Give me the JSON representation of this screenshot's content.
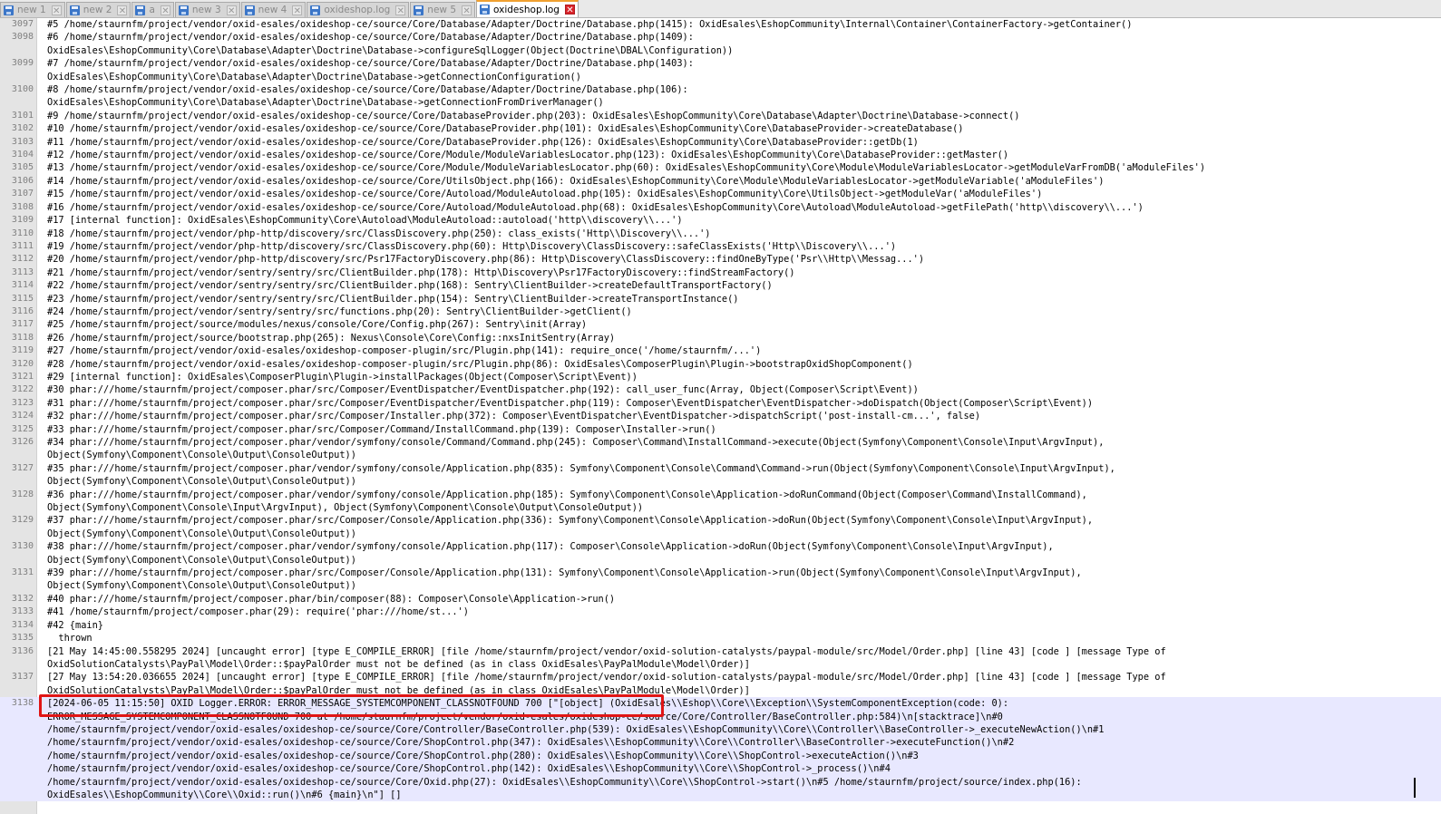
{
  "tabs": [
    {
      "label": "new 1",
      "active": false
    },
    {
      "label": "new 2",
      "active": false
    },
    {
      "label": "a",
      "active": false
    },
    {
      "label": "new 3",
      "active": false
    },
    {
      "label": "new 4",
      "active": false
    },
    {
      "label": "oxideshop.log",
      "active": false
    },
    {
      "label": "new 5",
      "active": false
    },
    {
      "label": "oxideshop.log",
      "active": true
    }
  ],
  "icons": {
    "tab_file": "save-disk-icon",
    "tab_close": "close-icon"
  },
  "colors": {
    "current_line_bg": "#e8e8ff",
    "highlight_box": "#e01515",
    "gutter_bg": "#e4e4e4",
    "active_tab_close": "#d9242b"
  },
  "editor": {
    "current_line": "3138",
    "lines": [
      {
        "num": "3097",
        "text": "#5 /home/staurnfm/project/vendor/oxid-esales/oxideshop-ce/source/Core/Database/Adapter/Doctrine/Database.php(1415): OxidEsales\\EshopCommunity\\Internal\\Container\\ContainerFactory->getContainer()"
      },
      {
        "num": "3098",
        "text": "#6 /home/staurnfm/project/vendor/oxid-esales/oxideshop-ce/source/Core/Database/Adapter/Doctrine/Database.php(1409):\nOxidEsales\\EshopCommunity\\Core\\Database\\Adapter\\Doctrine\\Database->configureSqlLogger(Object(Doctrine\\DBAL\\Configuration))"
      },
      {
        "num": "3099",
        "text": "#7 /home/staurnfm/project/vendor/oxid-esales/oxideshop-ce/source/Core/Database/Adapter/Doctrine/Database.php(1403):\nOxidEsales\\EshopCommunity\\Core\\Database\\Adapter\\Doctrine\\Database->getConnectionConfiguration()"
      },
      {
        "num": "3100",
        "text": "#8 /home/staurnfm/project/vendor/oxid-esales/oxideshop-ce/source/Core/Database/Adapter/Doctrine/Database.php(106):\nOxidEsales\\EshopCommunity\\Core\\Database\\Adapter\\Doctrine\\Database->getConnectionFromDriverManager()"
      },
      {
        "num": "3101",
        "text": "#9 /home/staurnfm/project/vendor/oxid-esales/oxideshop-ce/source/Core/DatabaseProvider.php(203): OxidEsales\\EshopCommunity\\Core\\Database\\Adapter\\Doctrine\\Database->connect()"
      },
      {
        "num": "3102",
        "text": "#10 /home/staurnfm/project/vendor/oxid-esales/oxideshop-ce/source/Core/DatabaseProvider.php(101): OxidEsales\\EshopCommunity\\Core\\DatabaseProvider->createDatabase()"
      },
      {
        "num": "3103",
        "text": "#11 /home/staurnfm/project/vendor/oxid-esales/oxideshop-ce/source/Core/DatabaseProvider.php(126): OxidEsales\\EshopCommunity\\Core\\DatabaseProvider::getDb(1)"
      },
      {
        "num": "3104",
        "text": "#12 /home/staurnfm/project/vendor/oxid-esales/oxideshop-ce/source/Core/Module/ModuleVariablesLocator.php(123): OxidEsales\\EshopCommunity\\Core\\DatabaseProvider::getMaster()"
      },
      {
        "num": "3105",
        "text": "#13 /home/staurnfm/project/vendor/oxid-esales/oxideshop-ce/source/Core/Module/ModuleVariablesLocator.php(60): OxidEsales\\EshopCommunity\\Core\\Module\\ModuleVariablesLocator->getModuleVarFromDB('aModuleFiles')"
      },
      {
        "num": "3106",
        "text": "#14 /home/staurnfm/project/vendor/oxid-esales/oxideshop-ce/source/Core/UtilsObject.php(166): OxidEsales\\EshopCommunity\\Core\\Module\\ModuleVariablesLocator->getModuleVariable('aModuleFiles')"
      },
      {
        "num": "3107",
        "text": "#15 /home/staurnfm/project/vendor/oxid-esales/oxideshop-ce/source/Core/Autoload/ModuleAutoload.php(105): OxidEsales\\EshopCommunity\\Core\\UtilsObject->getModuleVar('aModuleFiles')"
      },
      {
        "num": "3108",
        "text": "#16 /home/staurnfm/project/vendor/oxid-esales/oxideshop-ce/source/Core/Autoload/ModuleAutoload.php(68): OxidEsales\\EshopCommunity\\Core\\Autoload\\ModuleAutoload->getFilePath('http\\\\discovery\\\\...')"
      },
      {
        "num": "3109",
        "text": "#17 [internal function]: OxidEsales\\EshopCommunity\\Core\\Autoload\\ModuleAutoload::autoload('http\\\\discovery\\\\...')"
      },
      {
        "num": "3110",
        "text": "#18 /home/staurnfm/project/vendor/php-http/discovery/src/ClassDiscovery.php(250): class_exists('Http\\\\Discovery\\\\...')"
      },
      {
        "num": "3111",
        "text": "#19 /home/staurnfm/project/vendor/php-http/discovery/src/ClassDiscovery.php(60): Http\\Discovery\\ClassDiscovery::safeClassExists('Http\\\\Discovery\\\\...')"
      },
      {
        "num": "3112",
        "text": "#20 /home/staurnfm/project/vendor/php-http/discovery/src/Psr17FactoryDiscovery.php(86): Http\\Discovery\\ClassDiscovery::findOneByType('Psr\\\\Http\\\\Messag...')"
      },
      {
        "num": "3113",
        "text": "#21 /home/staurnfm/project/vendor/sentry/sentry/src/ClientBuilder.php(178): Http\\Discovery\\Psr17FactoryDiscovery::findStreamFactory()"
      },
      {
        "num": "3114",
        "text": "#22 /home/staurnfm/project/vendor/sentry/sentry/src/ClientBuilder.php(168): Sentry\\ClientBuilder->createDefaultTransportFactory()"
      },
      {
        "num": "3115",
        "text": "#23 /home/staurnfm/project/vendor/sentry/sentry/src/ClientBuilder.php(154): Sentry\\ClientBuilder->createTransportInstance()"
      },
      {
        "num": "3116",
        "text": "#24 /home/staurnfm/project/vendor/sentry/sentry/src/functions.php(20): Sentry\\ClientBuilder->getClient()"
      },
      {
        "num": "3117",
        "text": "#25 /home/staurnfm/project/source/modules/nexus/console/Core/Config.php(267): Sentry\\init(Array)"
      },
      {
        "num": "3118",
        "text": "#26 /home/staurnfm/project/source/bootstrap.php(265): Nexus\\Console\\Core\\Config::nxsInitSentry(Array)"
      },
      {
        "num": "3119",
        "text": "#27 /home/staurnfm/project/vendor/oxid-esales/oxideshop-composer-plugin/src/Plugin.php(141): require_once('/home/staurnfm/...')"
      },
      {
        "num": "3120",
        "text": "#28 /home/staurnfm/project/vendor/oxid-esales/oxideshop-composer-plugin/src/Plugin.php(86): OxidEsales\\ComposerPlugin\\Plugin->bootstrapOxidShopComponent()"
      },
      {
        "num": "3121",
        "text": "#29 [internal function]: OxidEsales\\ComposerPlugin\\Plugin->installPackages(Object(Composer\\Script\\Event))"
      },
      {
        "num": "3122",
        "text": "#30 phar:///home/staurnfm/project/composer.phar/src/Composer/EventDispatcher/EventDispatcher.php(192): call_user_func(Array, Object(Composer\\Script\\Event))"
      },
      {
        "num": "3123",
        "text": "#31 phar:///home/staurnfm/project/composer.phar/src/Composer/EventDispatcher/EventDispatcher.php(119): Composer\\EventDispatcher\\EventDispatcher->doDispatch(Object(Composer\\Script\\Event))"
      },
      {
        "num": "3124",
        "text": "#32 phar:///home/staurnfm/project/composer.phar/src/Composer/Installer.php(372): Composer\\EventDispatcher\\EventDispatcher->dispatchScript('post-install-cm...', false)"
      },
      {
        "num": "3125",
        "text": "#33 phar:///home/staurnfm/project/composer.phar/src/Composer/Command/InstallCommand.php(139): Composer\\Installer->run()"
      },
      {
        "num": "3126",
        "text": "#34 phar:///home/staurnfm/project/composer.phar/vendor/symfony/console/Command/Command.php(245): Composer\\Command\\InstallCommand->execute(Object(Symfony\\Component\\Console\\Input\\ArgvInput),\nObject(Symfony\\Component\\Console\\Output\\ConsoleOutput))"
      },
      {
        "num": "3127",
        "text": "#35 phar:///home/staurnfm/project/composer.phar/vendor/symfony/console/Application.php(835): Symfony\\Component\\Console\\Command\\Command->run(Object(Symfony\\Component\\Console\\Input\\ArgvInput),\nObject(Symfony\\Component\\Console\\Output\\ConsoleOutput))"
      },
      {
        "num": "3128",
        "text": "#36 phar:///home/staurnfm/project/composer.phar/vendor/symfony/console/Application.php(185): Symfony\\Component\\Console\\Application->doRunCommand(Object(Composer\\Command\\InstallCommand),\nObject(Symfony\\Component\\Console\\Input\\ArgvInput), Object(Symfony\\Component\\Console\\Output\\ConsoleOutput))"
      },
      {
        "num": "3129",
        "text": "#37 phar:///home/staurnfm/project/composer.phar/src/Composer/Console/Application.php(336): Symfony\\Component\\Console\\Application->doRun(Object(Symfony\\Component\\Console\\Input\\ArgvInput),\nObject(Symfony\\Component\\Console\\Output\\ConsoleOutput))"
      },
      {
        "num": "3130",
        "text": "#38 phar:///home/staurnfm/project/composer.phar/vendor/symfony/console/Application.php(117): Composer\\Console\\Application->doRun(Object(Symfony\\Component\\Console\\Input\\ArgvInput),\nObject(Symfony\\Component\\Console\\Output\\ConsoleOutput))"
      },
      {
        "num": "3131",
        "text": "#39 phar:///home/staurnfm/project/composer.phar/src/Composer/Console/Application.php(131): Symfony\\Component\\Console\\Application->run(Object(Symfony\\Component\\Console\\Input\\ArgvInput),\nObject(Symfony\\Component\\Console\\Output\\ConsoleOutput))"
      },
      {
        "num": "3132",
        "text": "#40 phar:///home/staurnfm/project/composer.phar/bin/composer(88): Composer\\Console\\Application->run()"
      },
      {
        "num": "3133",
        "text": "#41 /home/staurnfm/project/composer.phar(29): require('phar:///home/st...')"
      },
      {
        "num": "3134",
        "text": "#42 {main}"
      },
      {
        "num": "3135",
        "text": "  thrown"
      },
      {
        "num": "3136",
        "text": "[21 May 14:45:00.558295 2024] [uncaught error] [type E_COMPILE_ERROR] [file /home/staurnfm/project/vendor/oxid-solution-catalysts/paypal-module/src/Model/Order.php] [line 43] [code ] [message Type of\nOxidSolutionCatalysts\\PayPal\\Model\\Order::$payPalOrder must not be defined (as in class OxidEsales\\PayPalModule\\Model\\Order)]"
      },
      {
        "num": "3137",
        "text": "[27 May 13:54:20.036655 2024] [uncaught error] [type E_COMPILE_ERROR] [file /home/staurnfm/project/vendor/oxid-solution-catalysts/paypal-module/src/Model/Order.php] [line 43] [code ] [message Type of\nOxidSolutionCatalysts\\PayPal\\Model\\Order::$payPalOrder must not be defined (as in class OxidEsales\\PayPalModule\\Model\\Order)]"
      },
      {
        "num": "3138",
        "text": "[2024-06-05 11:15:50] OXID Logger.ERROR: ERROR_MESSAGE_SYSTEMCOMPONENT_CLASSNOTFOUND 700 [\"[object] (OxidEsales\\\\Eshop\\\\Core\\\\Exception\\\\SystemComponentException(code: 0):\nERROR_MESSAGE_SYSTEMCOMPONENT_CLASSNOTFOUND 700 at /home/staurnfm/project/vendor/oxid-esales/oxideshop-ce/source/Core/Controller/BaseController.php:584)\\n[stacktrace]\\n#0\n/home/staurnfm/project/vendor/oxid-esales/oxideshop-ce/source/Core/Controller/BaseController.php(539): OxidEsales\\\\EshopCommunity\\\\Core\\\\Controller\\\\BaseController->_executeNewAction()\\n#1\n/home/staurnfm/project/vendor/oxid-esales/oxideshop-ce/source/Core/ShopControl.php(347): OxidEsales\\\\EshopCommunity\\\\Core\\\\Controller\\\\BaseController->executeFunction()\\n#2\n/home/staurnfm/project/vendor/oxid-esales/oxideshop-ce/source/Core/ShopControl.php(280): OxidEsales\\\\EshopCommunity\\\\Core\\\\ShopControl->executeAction()\\n#3\n/home/staurnfm/project/vendor/oxid-esales/oxideshop-ce/source/Core/ShopControl.php(142): OxidEsales\\\\EshopCommunity\\\\Core\\\\ShopControl->_process()\\n#4\n/home/staurnfm/project/vendor/oxid-esales/oxideshop-ce/source/Core/Oxid.php(27): OxidEsales\\\\EshopCommunity\\\\Core\\\\ShopControl->start()\\n#5 /home/staurnfm/project/source/index.php(16):\nOxidEsales\\\\EshopCommunity\\\\Core\\\\Oxid::run()\\n#6 {main}\\n\"] []"
      }
    ]
  }
}
